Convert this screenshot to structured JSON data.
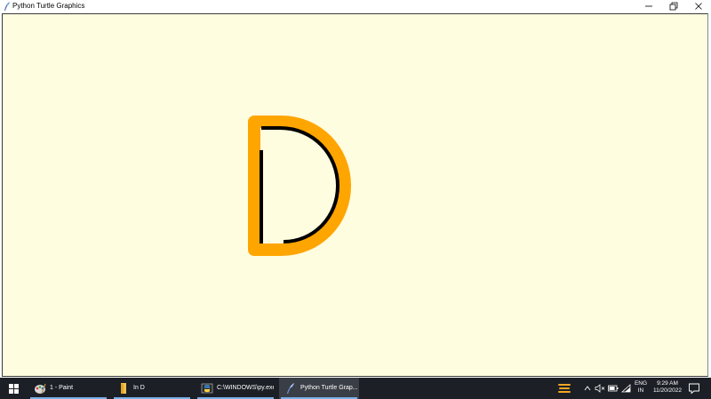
{
  "window": {
    "title": "Python Turtle Graphics",
    "icon": "feather-icon"
  },
  "canvas": {
    "background": "#fffde0",
    "letter_outline_color": "#ffa500",
    "letter_stroke_color": "#000000"
  },
  "taskbar": {
    "items": [
      {
        "label": "1 - Paint",
        "icon": "paint-icon",
        "active": false
      },
      {
        "label": "In D",
        "icon": "folder-icon",
        "active": false
      },
      {
        "label": "C:\\WINDOWS\\py.exe",
        "icon": "python-console-icon",
        "active": false
      },
      {
        "label": "Python Turtle Grap...",
        "icon": "feather-icon",
        "active": true
      }
    ],
    "lang_line1": "ENG",
    "lang_line2": "IN",
    "time": "9:29 AM",
    "date": "11/20/2022"
  }
}
